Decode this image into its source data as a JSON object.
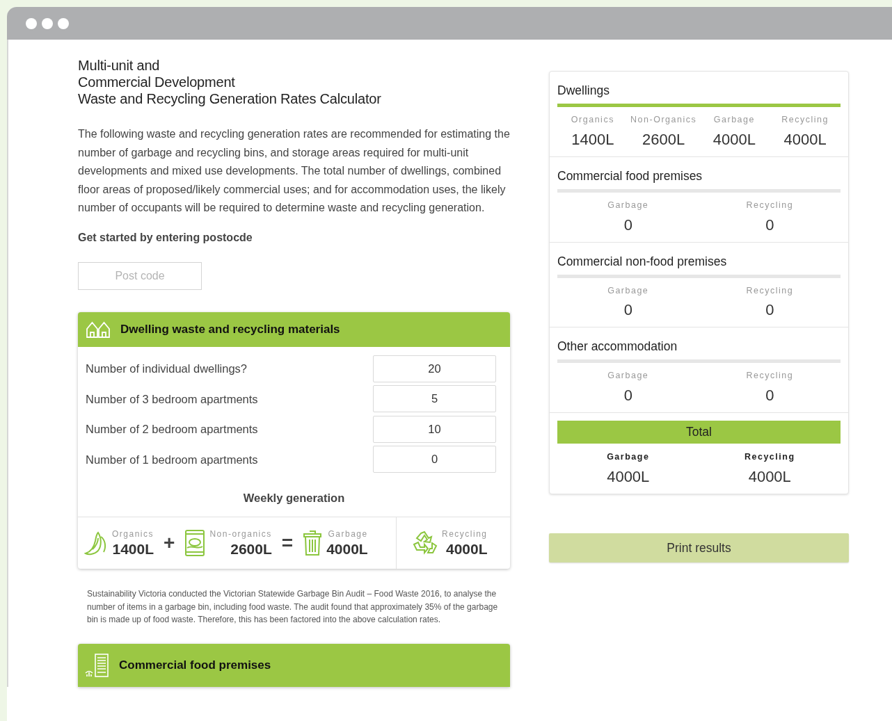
{
  "title_lines": [
    "Multi-unit and",
    "Commercial Development",
    "Waste and Recycling Generation Rates Calculator"
  ],
  "intro": "The following waste and recycling generation rates are recommended for estimating the number of garbage and recycling bins, and storage areas required for multi-unit developments and mixed use developments. The total number of dwellings, combined floor areas of proposed/likely commercial uses; and for accommodation uses, the likely number of occupants will be required to determine waste and recycling generation.",
  "postcode": {
    "heading": "Get started by entering postocde",
    "placeholder": "Post code"
  },
  "dwelling_panel": {
    "title": "Dwelling waste and recycling materials",
    "fields": [
      {
        "label": "Number of individual dwellings?",
        "value": "20"
      },
      {
        "label": "Number of 3 bedroom apartments",
        "value": "5"
      },
      {
        "label": "Number of 2 bedroom apartments",
        "value": "10"
      },
      {
        "label": "Number of 1 bedroom apartments",
        "value": "0"
      }
    ],
    "weekly_heading": "Weekly generation",
    "weekly": [
      {
        "kind": "organics",
        "label": "Organics",
        "value": "1400L"
      },
      {
        "kind": "operator",
        "symbol": "+"
      },
      {
        "kind": "non_organics",
        "label": "Non-organics",
        "value": "2600L"
      },
      {
        "kind": "operator",
        "symbol": "="
      },
      {
        "kind": "garbage",
        "label": "Garbage",
        "value": "4000L"
      },
      {
        "kind": "recycling",
        "label": "Recycling",
        "value": "4000L"
      }
    ]
  },
  "footnote": "Sustainability Victoria conducted the Victorian Statewide Garbage Bin Audit – Food Waste 2016, to analyse the number of items in a garbage bin, including food waste. The audit found that approximately 35% of the garbage bin is made up of food waste. Therefore, this has been factored into the above calculation rates.",
  "commercial_panel": {
    "title": "Commercial food premises"
  },
  "summary": {
    "sections": [
      {
        "title": "Dwellings",
        "highlighted": true,
        "stats": [
          {
            "label": "Organics",
            "value": "1400L"
          },
          {
            "label": "Non-Organics",
            "value": "2600L"
          },
          {
            "label": "Garbage",
            "value": "4000L"
          },
          {
            "label": "Recycling",
            "value": "4000L"
          }
        ]
      },
      {
        "title": "Commercial food premises",
        "highlighted": false,
        "stats": [
          {
            "label": "Garbage",
            "value": "0"
          },
          {
            "label": "Recycling",
            "value": "0"
          }
        ]
      },
      {
        "title": "Commercial non-food premises",
        "highlighted": false,
        "stats": [
          {
            "label": "Garbage",
            "value": "0"
          },
          {
            "label": "Recycling",
            "value": "0"
          }
        ]
      },
      {
        "title": "Other accommodation",
        "highlighted": false,
        "stats": [
          {
            "label": "Garbage",
            "value": "0"
          },
          {
            "label": "Recycling",
            "value": "0"
          }
        ]
      }
    ],
    "total": {
      "title": "Total",
      "stats": [
        {
          "label": "Garbage",
          "value": "4000L"
        },
        {
          "label": "Recycling",
          "value": "4000L"
        }
      ]
    }
  },
  "print_button": "Print results"
}
